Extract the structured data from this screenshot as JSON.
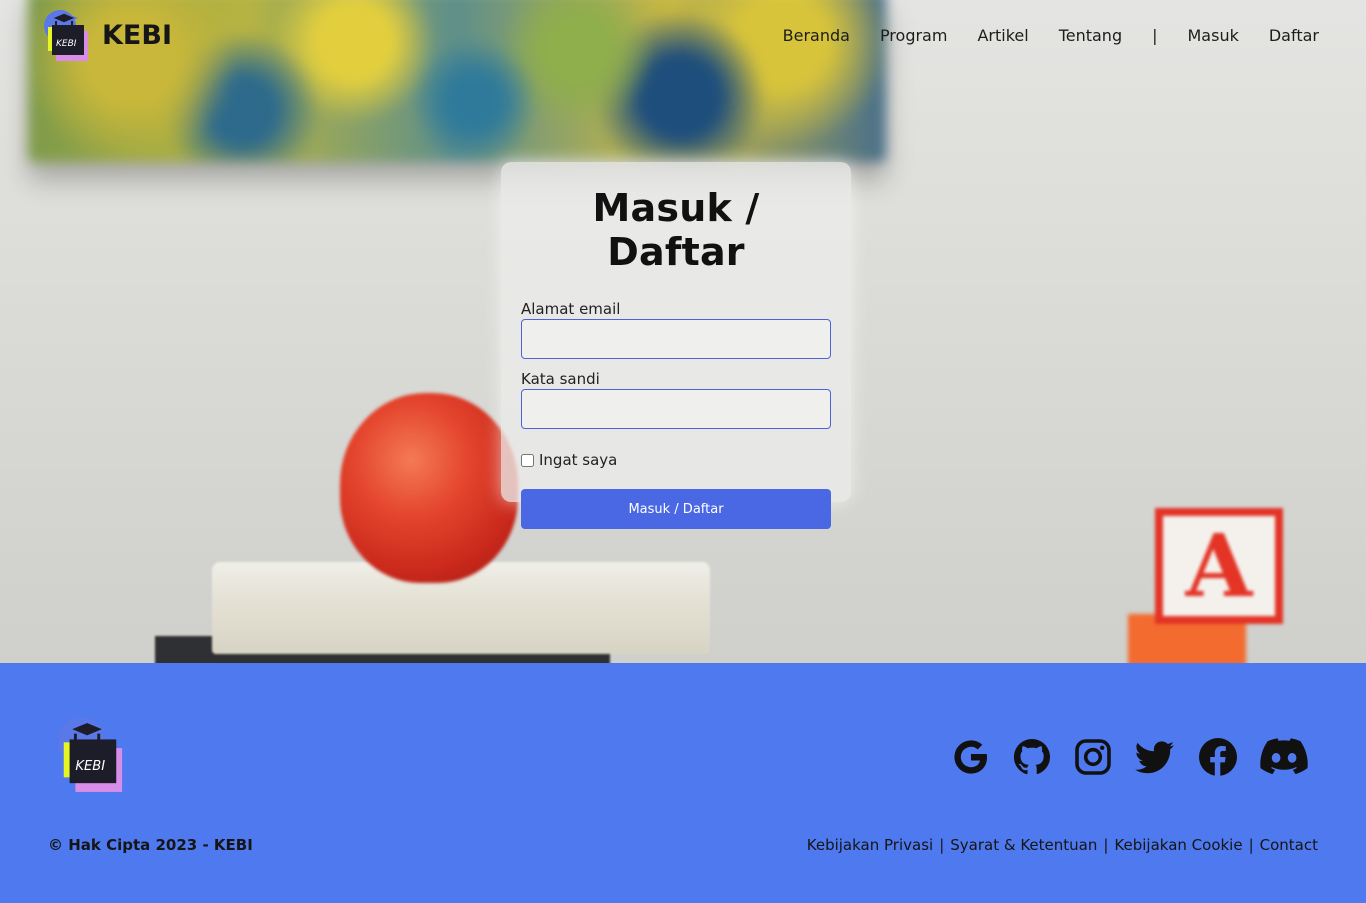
{
  "nav": {
    "brand": "KEBI",
    "logo_text": "KEBI",
    "items": [
      {
        "label": "Beranda"
      },
      {
        "label": "Program"
      },
      {
        "label": "Artikel"
      },
      {
        "label": "Tentang"
      }
    ],
    "separator": "|",
    "login": "Masuk",
    "register": "Daftar"
  },
  "form": {
    "title": "Masuk / Daftar",
    "email_label": "Alamat email",
    "email_value": "",
    "password_label": "Kata sandi",
    "password_value": "",
    "remember_label": "Ingat saya",
    "remember_checked": false,
    "submit_label": "Masuk / Daftar"
  },
  "footer": {
    "logo_text": "KEBI",
    "copyright": "© Hak Cipta 2023 - KEBI",
    "links": [
      {
        "label": "Kebijakan Privasi"
      },
      {
        "label": "Syarat & Ketentuan"
      },
      {
        "label": "Kebijakan Cookie"
      },
      {
        "label": "Contact"
      }
    ],
    "link_separator": "|",
    "socials": [
      "google-icon",
      "github-icon",
      "instagram-icon",
      "twitter-icon",
      "facebook-icon",
      "discord-icon"
    ]
  },
  "colors": {
    "primary_button": "#4a68e4",
    "footer_bg": "#4f7aef",
    "input_border": "#4d62d8"
  }
}
